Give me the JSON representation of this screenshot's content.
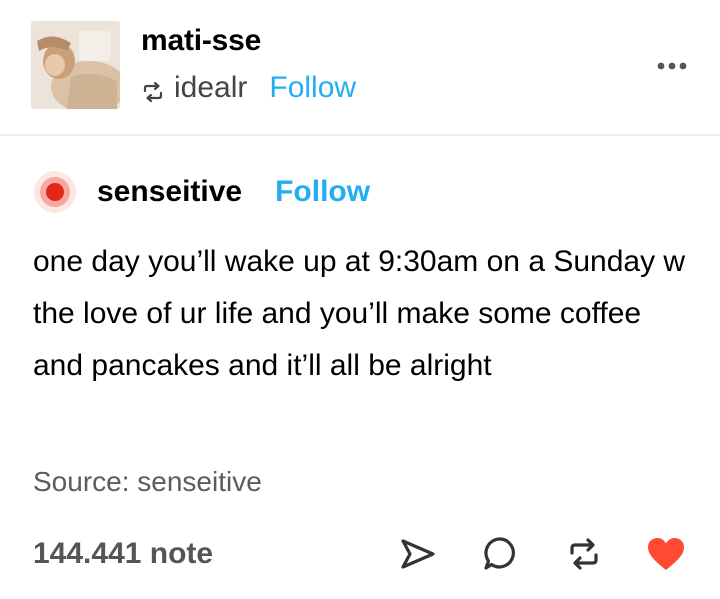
{
  "header": {
    "blog_name": "mati-sse",
    "reblogged_from": "idealr",
    "follow_label": "Follow",
    "more_icon": "more-horizontal-icon",
    "reblog_icon": "reblog-icon"
  },
  "post": {
    "author": "senseitive",
    "follow_label": "Follow",
    "body": "one day you’ll wake up at 9:30am on a Sunday w the love of ur life and you’ll make some coffee and pancakes and it’ll all be alright",
    "source": "Source: senseitive"
  },
  "footer": {
    "notes": "144.441 note",
    "actions": [
      "share-icon",
      "reply-icon",
      "reblog-icon",
      "like-icon"
    ],
    "like_color": "#ff4930"
  },
  "colors": {
    "follow": "#22aef0",
    "secondary_text": "#5c5c5c",
    "notes_text": "#555555",
    "avatar_red": "#e2261b"
  }
}
